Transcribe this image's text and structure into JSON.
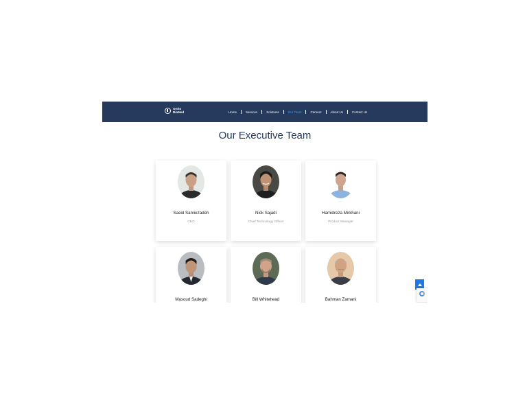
{
  "brand": {
    "logo_text": "Ortho BioMed"
  },
  "nav": {
    "items": [
      {
        "label": "Home",
        "active": false
      },
      {
        "label": "Services",
        "active": false
      },
      {
        "label": "Solutions",
        "active": false
      },
      {
        "label": "Our Team",
        "active": true
      },
      {
        "label": "Careers",
        "active": false
      },
      {
        "label": "About Us",
        "active": false
      },
      {
        "label": "Contact Us",
        "active": false
      }
    ]
  },
  "main": {
    "title": "Our Executive Team",
    "members": [
      {
        "name": "Saeid Samiezadeh",
        "role": "CEO"
      },
      {
        "name": "Nick Sajadi",
        "role": "Chief Technology Officer"
      },
      {
        "name": "Hamidreza Mirkhani",
        "role": "Product Manager"
      },
      {
        "name": "Masoud Sadeghi",
        "role": ""
      },
      {
        "name": "Bill Whitehead",
        "role": ""
      },
      {
        "name": "Bahman Zamani",
        "role": ""
      }
    ]
  },
  "widgets": {
    "scroll_top_icon": "arrow-up-icon",
    "recaptcha_icon": "recaptcha-icon"
  },
  "colors": {
    "navbar": "#263a5e",
    "active_link": "#3fa0e8",
    "title": "#263a5e",
    "scroll_button": "#1e7be6"
  }
}
